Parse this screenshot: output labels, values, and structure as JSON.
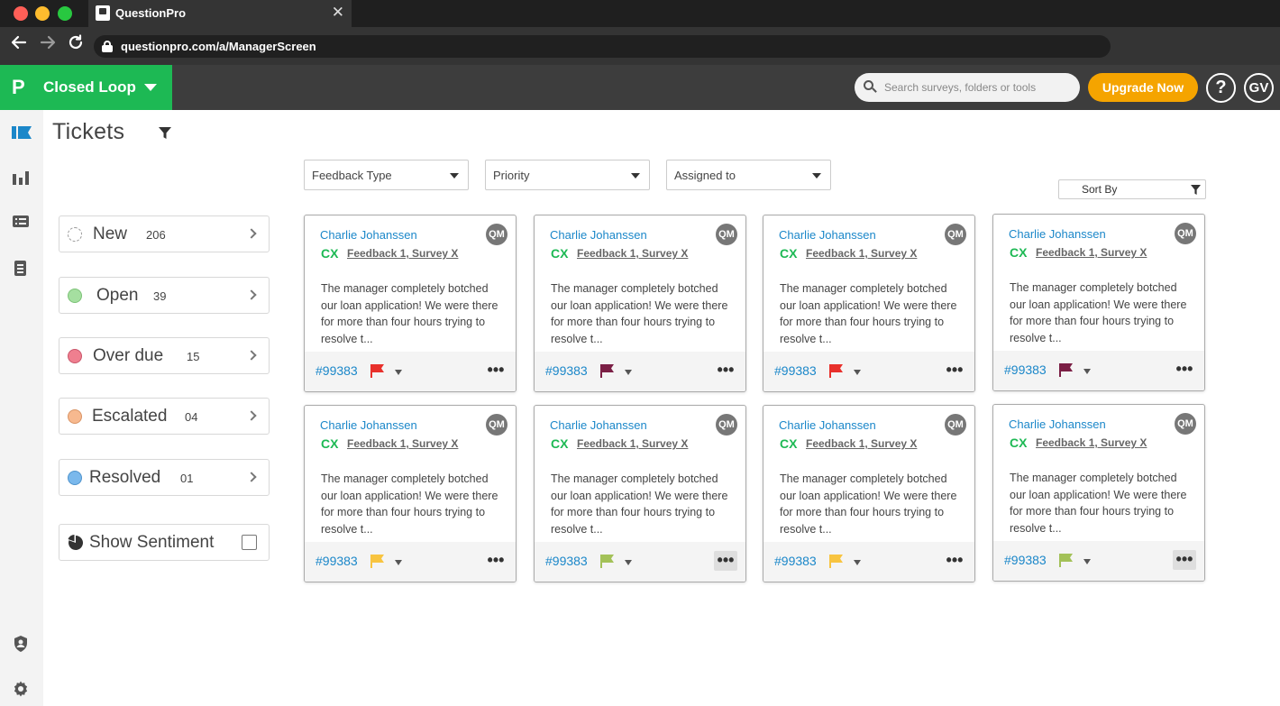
{
  "browser": {
    "tab_title": "QuestionPro",
    "tab_close": "✕",
    "url": "questionpro.com/a/ManagerScreen",
    "traffic_colors": [
      "#ff5f57",
      "#febc2e",
      "#28c840"
    ]
  },
  "header": {
    "logo_glyph": "P",
    "product": "Closed Loop",
    "search_placeholder": "Search surveys, folders or tools",
    "upgrade_label": "Upgrade Now",
    "help_label": "?",
    "avatar_initials": "GV",
    "brand_color": "#1db954",
    "upgrade_color": "#f5a400"
  },
  "rail": {
    "top_icons": [
      "tickets-icon",
      "bar-chart-icon",
      "list-icon",
      "document-icon"
    ],
    "bottom_icons": [
      "shield-user-icon",
      "gear-icon"
    ]
  },
  "page": {
    "title": "Tickets"
  },
  "statuses": [
    {
      "label": "New",
      "count": "206",
      "dot": "dashed"
    },
    {
      "label": "Open",
      "count": "39",
      "dot": "#a5dfa0"
    },
    {
      "label": "Over due",
      "count": "15",
      "dot": "#ef7f8f"
    },
    {
      "label": "Escalated",
      "count": "04",
      "dot": "#f7b98f"
    },
    {
      "label": "Resolved",
      "count": "01",
      "dot": "#7ab8ec"
    }
  ],
  "sentiment": {
    "label": "Show Sentiment",
    "checked": false
  },
  "filters": {
    "feedback_type": "Feedback Type",
    "priority": "Priority",
    "assigned_to": "Assigned to",
    "sort_by": "Sort By"
  },
  "cards": [
    {
      "name": "Charlie Johanssen",
      "avatar": "QM",
      "tag": "CX",
      "source": "Feedback 1, Survey X",
      "text": "The manager completely botched our loan application! We were there for more than four hours trying to resolve t...",
      "id": "#99383",
      "flag_color": "#e8302b",
      "more": "•••",
      "more_active": false
    },
    {
      "name": "Charlie Johanssen",
      "avatar": "QM",
      "tag": "CX",
      "source": "Feedback 1, Survey X",
      "text": "The manager completely botched our loan application! We were there for more than four hours trying to resolve t...",
      "id": "#99383",
      "flag_color": "#7b1f45",
      "more": "•••",
      "more_active": false
    },
    {
      "name": "Charlie Johanssen",
      "avatar": "QM",
      "tag": "CX",
      "source": "Feedback 1, Survey X",
      "text": "The manager completely botched our loan application! We were there for more than four hours trying to resolve t...",
      "id": "#99383",
      "flag_color": "#e8302b",
      "more": "•••",
      "more_active": false
    },
    {
      "name": "Charlie Johanssen",
      "avatar": "QM",
      "tag": "CX",
      "source": "Feedback 1, Survey X",
      "text": "The manager completely botched our loan application! We were there for more than four hours trying to resolve t...",
      "id": "#99383",
      "flag_color": "#7b1f45",
      "more": "•••",
      "more_active": false
    },
    {
      "name": "Charlie Johanssen",
      "avatar": "QM",
      "tag": "CX",
      "source": "Feedback 1, Survey X",
      "text": "The manager completely botched our loan application! We were there for more than four hours trying to resolve t...",
      "id": "#99383",
      "flag_color": "#f8c440",
      "more": "•••",
      "more_active": false
    },
    {
      "name": "Charlie Johanssen",
      "avatar": "QM",
      "tag": "CX",
      "source": "Feedback 1, Survey X",
      "text": "The manager completely botched our loan application! We were there for more than four hours trying to resolve t...",
      "id": "#99383",
      "flag_color": "#a3c158",
      "more": "•••",
      "more_active": true
    },
    {
      "name": "Charlie Johanssen",
      "avatar": "QM",
      "tag": "CX",
      "source": "Feedback 1, Survey X",
      "text": "The manager completely botched our loan application! We were there for more than four hours trying to resolve t...",
      "id": "#99383",
      "flag_color": "#f8c440",
      "more": "•••",
      "more_active": false
    },
    {
      "name": "Charlie Johanssen",
      "avatar": "QM",
      "tag": "CX",
      "source": "Feedback 1, Survey X",
      "text": "The manager completely botched our loan application! We were there for more than four hours trying to resolve t...",
      "id": "#99383",
      "flag_color": "#a3c158",
      "more": "•••",
      "more_active": true
    }
  ]
}
